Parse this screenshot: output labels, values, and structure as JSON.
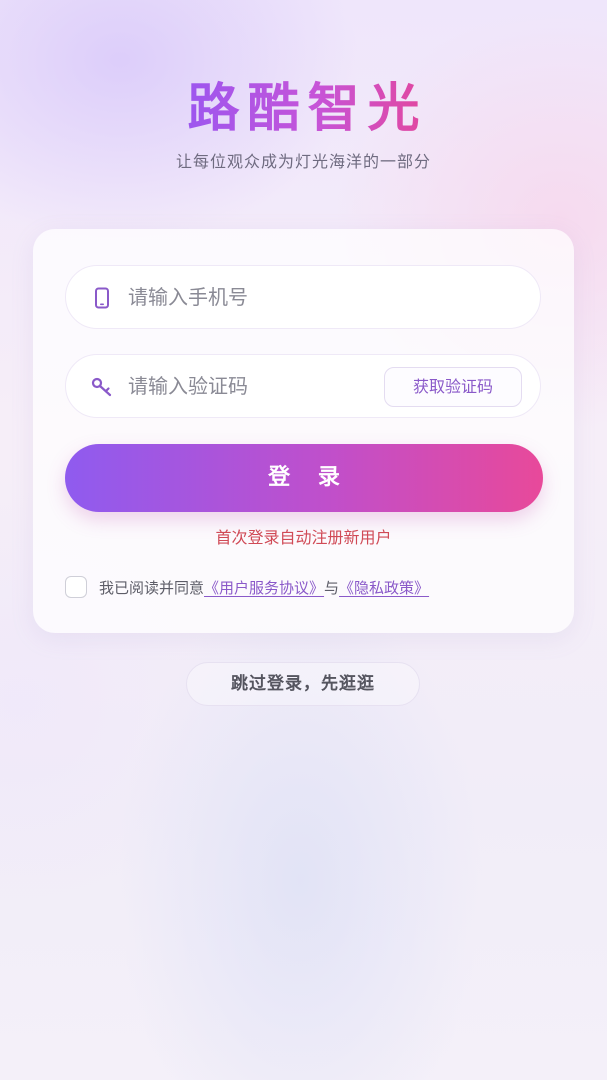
{
  "header": {
    "app_title": "路酷智光",
    "slogan": "让每位观众成为灯光海洋的一部分"
  },
  "form": {
    "phone": {
      "icon": "phone-icon",
      "placeholder": "请输入手机号",
      "value": ""
    },
    "code": {
      "icon": "key-icon",
      "placeholder": "请输入验证码",
      "value": "",
      "send_code_label": "获取验证码"
    },
    "login_label": "登 录",
    "first_login_hint": "首次登录自动注册新用户",
    "agreement": {
      "checked": false,
      "prefix": "我已阅读并同意",
      "user_agreement": "《用户服务协议》",
      "conjunction": "与",
      "privacy_policy": "《隐私政策》"
    }
  },
  "skip_label": "跳过登录，先逛逛",
  "colors": {
    "accent_purple": "#8f5bef",
    "accent_pink": "#e8499a",
    "link": "#8a59c9",
    "hint_red": "#d04a56"
  }
}
